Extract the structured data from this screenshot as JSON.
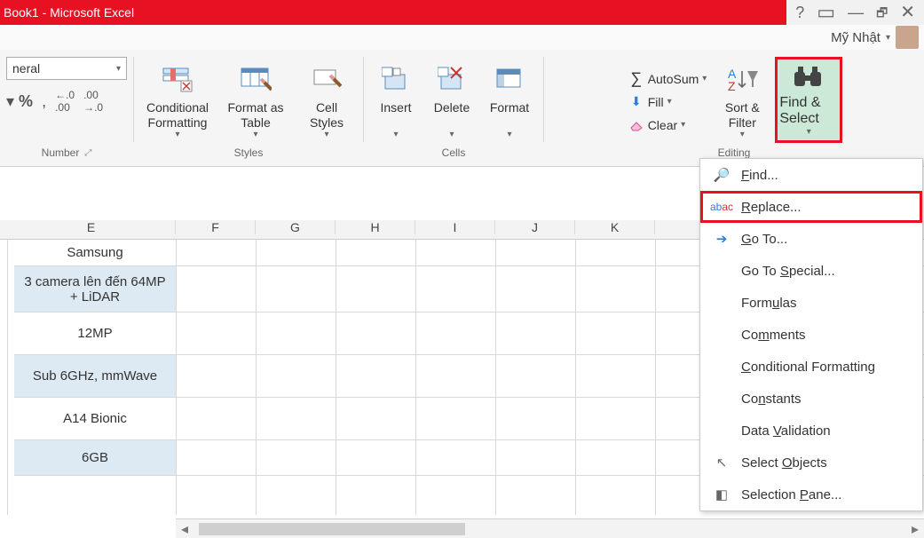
{
  "title": "Book1 -  Microsoft Excel",
  "user_name": "Mỹ Nhật",
  "number_group": {
    "label": "Number",
    "format_name": "neral",
    "btns": [
      "%",
      ",",
      ".0 .00",
      ".00 .0"
    ]
  },
  "styles_group": {
    "label": "Styles",
    "conditional": "Conditional Formatting",
    "format_as": "Format as Table",
    "cell_styles": "Cell Styles"
  },
  "cells_group": {
    "label": "Cells",
    "insert": "Insert",
    "delete": "Delete",
    "format": "Format"
  },
  "editing_group": {
    "label": "Editing",
    "autosum": "AutoSum",
    "fill": "Fill",
    "clear": "Clear",
    "sort_filter": "Sort & Filter",
    "find_select": "Find & Select"
  },
  "menu": {
    "find": "Find...",
    "replace": "Replace...",
    "goto": "Go To...",
    "goto_special": "Go To Special...",
    "formulas": "Formulas",
    "comments": "Comments",
    "cond_fmt": "Conditional Formatting",
    "constants": "Constants",
    "data_val": "Data Validation",
    "sel_obj": "Select Objects",
    "sel_pane": "Selection Pane..."
  },
  "columns": [
    "E",
    "F",
    "G",
    "H",
    "I",
    "J",
    "K"
  ],
  "cells_E": [
    "Samsung",
    "3 camera lên đến 64MP + LiDAR",
    "12MP",
    "Sub 6GHz, mmWave",
    "A14 Bionic",
    "6GB"
  ]
}
